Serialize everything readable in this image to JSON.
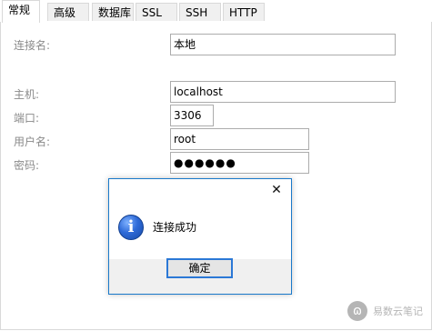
{
  "tabs": [
    {
      "label": "常规",
      "active": true
    },
    {
      "label": "高级",
      "active": false
    },
    {
      "label": "数据库",
      "active": false
    },
    {
      "label": "SSL",
      "active": false
    },
    {
      "label": "SSH",
      "active": false
    },
    {
      "label": "HTTP",
      "active": false
    }
  ],
  "form": {
    "connection_name_label": "连接名:",
    "connection_name_value": "本地",
    "host_label": "主机:",
    "host_value": "localhost",
    "port_label": "端口:",
    "port_value": "3306",
    "username_label": "用户名:",
    "username_value": "root",
    "password_label": "密码:",
    "password_value": "●●●●●●"
  },
  "dialog": {
    "close_glyph": "✕",
    "message": "连接成功",
    "ok_label": "确定",
    "icon": "info-icon",
    "icon_glyph": "i"
  },
  "watermark": {
    "text": "易数云笔记",
    "logo_glyph": "ɷ"
  },
  "colors": {
    "accent": "#1979ca",
    "label_gray": "#8a8a8a",
    "dialog_bg": "#f0f0f0"
  }
}
